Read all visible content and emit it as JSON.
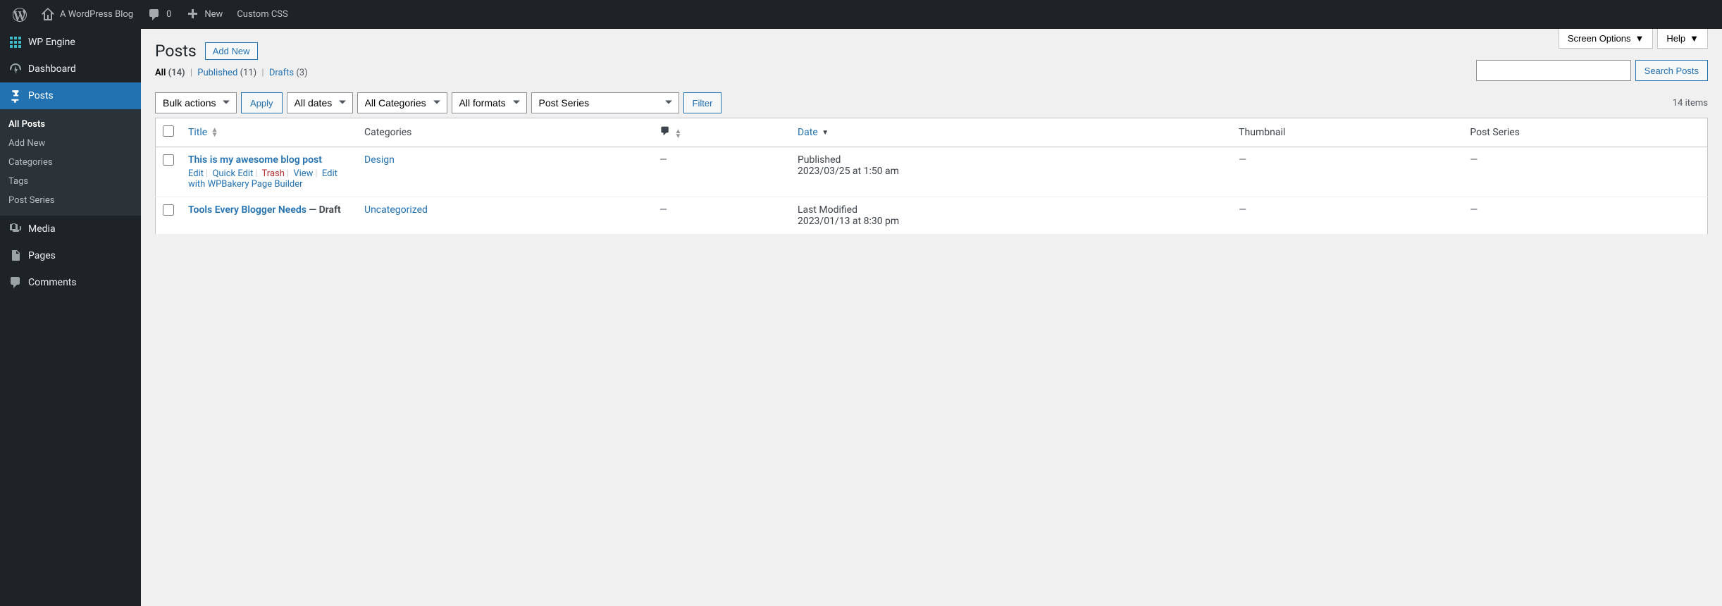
{
  "adminbar": {
    "site_name": "A WordPress Blog",
    "comments_count": "0",
    "new_label": "New",
    "custom_css_label": "Custom CSS"
  },
  "sidebar": {
    "items": [
      {
        "label": "WP Engine",
        "icon": "wpengine"
      },
      {
        "label": "Dashboard",
        "icon": "dashboard"
      },
      {
        "label": "Posts",
        "icon": "pin",
        "current": true
      },
      {
        "label": "Media",
        "icon": "media"
      },
      {
        "label": "Pages",
        "icon": "pages"
      },
      {
        "label": "Comments",
        "icon": "comments"
      }
    ],
    "posts_submenu": [
      {
        "label": "All Posts",
        "current": true
      },
      {
        "label": "Add New"
      },
      {
        "label": "Categories"
      },
      {
        "label": "Tags"
      },
      {
        "label": "Post Series"
      }
    ]
  },
  "top_buttons": {
    "screen_options": "Screen Options",
    "help": "Help"
  },
  "page": {
    "title": "Posts",
    "add_new": "Add New"
  },
  "views": {
    "all_label": "All",
    "all_count": "(14)",
    "published_label": "Published",
    "published_count": "(11)",
    "drafts_label": "Drafts",
    "drafts_count": "(3)"
  },
  "search": {
    "button": "Search Posts"
  },
  "filters": {
    "bulk_actions": "Bulk actions",
    "apply": "Apply",
    "all_dates": "All dates",
    "all_categories": "All Categories",
    "all_formats": "All formats",
    "post_series": "Post Series",
    "filter": "Filter",
    "item_count": "14 items"
  },
  "columns": {
    "title": "Title",
    "categories": "Categories",
    "date": "Date",
    "thumbnail": "Thumbnail",
    "post_series": "Post Series"
  },
  "rows": [
    {
      "title": "This is my awesome blog post",
      "category": "Design",
      "comments": "—",
      "date_status": "Published",
      "date_time": "2023/03/25 at 1:50 am",
      "thumbnail": "—",
      "post_series": "—",
      "show_actions": true,
      "actions": {
        "edit": "Edit",
        "quick_edit": "Quick Edit",
        "trash": "Trash",
        "view": "View",
        "edit_bakery": "Edit with WPBakery Page Builder"
      }
    },
    {
      "title": "Tools Every Blogger Needs",
      "title_suffix": " — Draft",
      "category": "Uncategorized",
      "comments": "—",
      "date_status": "Last Modified",
      "date_time": "2023/01/13 at 8:30 pm",
      "thumbnail": "—",
      "post_series": "—"
    }
  ]
}
